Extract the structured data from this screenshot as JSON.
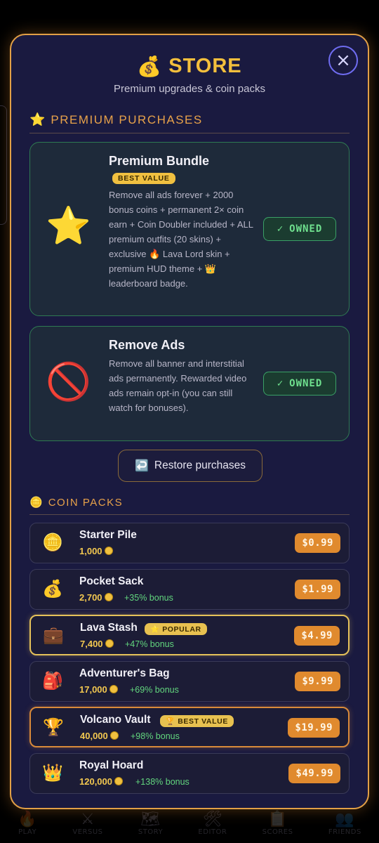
{
  "bottom_nav": {
    "items": [
      {
        "label": "PLAY",
        "icon": "🔥"
      },
      {
        "label": "VERSUS",
        "icon": "⚔"
      },
      {
        "label": "STORY",
        "icon": "🗺"
      },
      {
        "label": "EDITOR",
        "icon": "🛠"
      },
      {
        "label": "SCORES",
        "icon": "📋"
      },
      {
        "label": "FRIENDS",
        "icon": "👥"
      }
    ]
  },
  "store": {
    "close_icon": "×",
    "title_icon": "💰",
    "title": "STORE",
    "subtitle": "Premium upgrades & coin packs",
    "premium_section": {
      "icon": "⭐",
      "label": "PREMIUM PURCHASES"
    },
    "premium_items": [
      {
        "icon": "⭐",
        "name": "Premium Bundle",
        "badge": "BEST VALUE",
        "description": "Remove all ads forever + 2000 bonus coins + permanent 2× coin earn + Coin Doubler included + ALL premium outfits (20 skins) + exclusive 🔥 Lava Lord skin + premium HUD theme + 👑 leaderboard badge.",
        "status": "OWNED",
        "status_icon": "✓"
      },
      {
        "icon": "🚫",
        "name": "Remove Ads",
        "description": "Remove all banner and interstitial ads permanently. Rewarded video ads remain opt-in (you can still watch for bonuses).",
        "status": "OWNED",
        "status_icon": "✓"
      }
    ],
    "restore": {
      "icon": "↩️",
      "label": "Restore purchases"
    },
    "coin_section": {
      "icon": "🪙",
      "label": "COIN PACKS"
    },
    "coin_packs": [
      {
        "icon": "🪙",
        "name": "Starter Pile",
        "amount": "1,000",
        "bonus": "",
        "price": "$0.99",
        "tag": ""
      },
      {
        "icon": "💰",
        "name": "Pocket Sack",
        "amount": "2,700",
        "bonus": "+35% bonus",
        "price": "$1.99",
        "tag": ""
      },
      {
        "icon": "💼",
        "name": "Lava Stash",
        "amount": "7,400",
        "bonus": "+47% bonus",
        "price": "$4.99",
        "tag": "⭐ POPULAR"
      },
      {
        "icon": "🎒",
        "name": "Adventurer's Bag",
        "amount": "17,000",
        "bonus": "+69% bonus",
        "price": "$9.99",
        "tag": ""
      },
      {
        "icon": "🏆",
        "name": "Volcano Vault",
        "amount": "40,000",
        "bonus": "+98% bonus",
        "price": "$19.99",
        "tag": "🏆 BEST VALUE"
      },
      {
        "icon": "👑",
        "name": "Royal Hoard",
        "amount": "120,000",
        "bonus": "+138% bonus",
        "price": "$49.99",
        "tag": ""
      }
    ]
  },
  "colors": {
    "accent_gold": "#f3bf3c",
    "accent_orange": "#e08a2e",
    "owned_green": "#6fe08e",
    "modal_border": "#e2a046",
    "modal_bg": "#1a1a40"
  }
}
